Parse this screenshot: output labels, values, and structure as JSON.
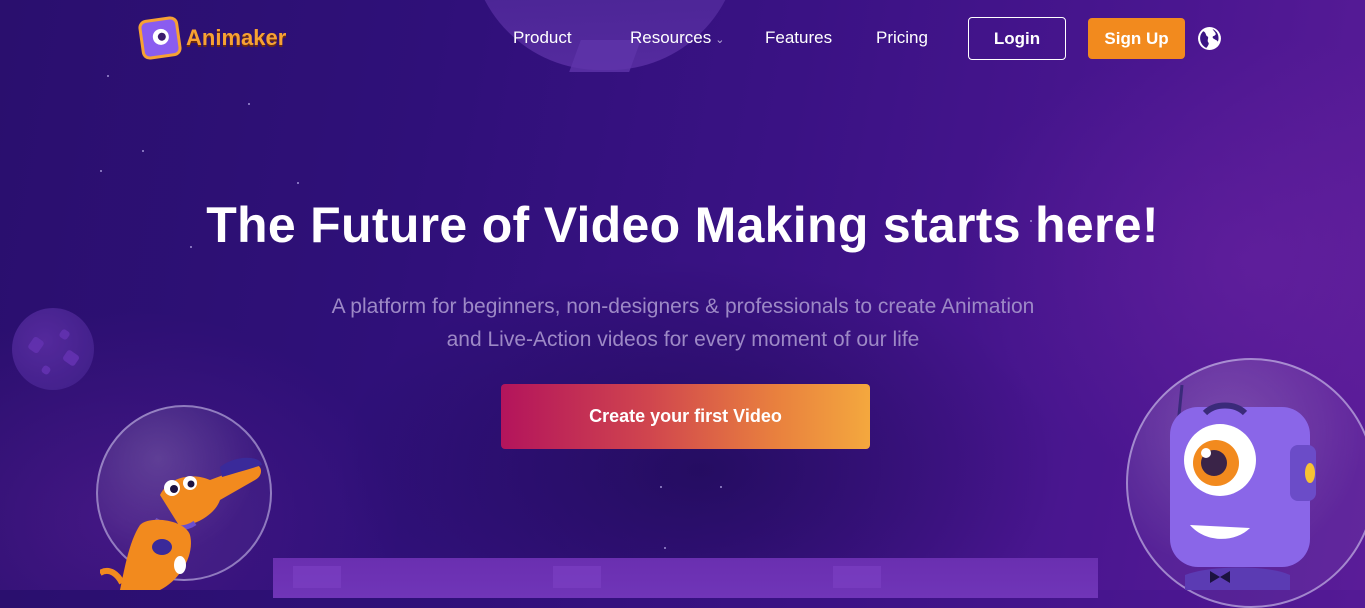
{
  "brand": {
    "name": "Animaker"
  },
  "nav": {
    "product": "Product",
    "resources": "Resources",
    "features": "Features",
    "pricing": "Pricing",
    "login": "Login",
    "signup": "Sign Up",
    "language_icon": "globe-icon"
  },
  "hero": {
    "title": "The Future of Video Making starts here!",
    "subtitle_line1": "A platform for beginners, non-designers & professionals to create Animation",
    "subtitle_line2": "and Live-Action videos for every moment of our life",
    "cta": "Create your first Video"
  },
  "colors": {
    "accent_orange": "#f28a1e",
    "background_purple": "#33117c",
    "cta_gradient_start": "#b3145c",
    "cta_gradient_end": "#f4a83e"
  }
}
